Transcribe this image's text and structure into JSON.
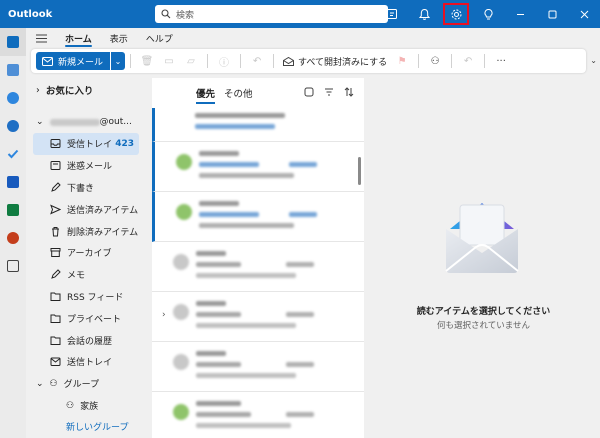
{
  "app": {
    "title": "Outlook"
  },
  "search": {
    "placeholder": "検索"
  },
  "titlebar": {
    "icons": [
      "note-icon",
      "bell-icon",
      "gear-icon",
      "lightbulb-icon",
      "minimize-icon",
      "maximize-icon",
      "close-icon"
    ],
    "highlight_color": "#e81123"
  },
  "rail": {
    "items": [
      "mail-icon",
      "calendar-icon",
      "people-icon",
      "groups-icon",
      "todo-icon",
      "word-icon",
      "excel-icon",
      "powerpoint-icon",
      "apps-icon"
    ]
  },
  "tabs": [
    {
      "label": "ホーム",
      "active": true
    },
    {
      "label": "表示",
      "active": false
    },
    {
      "label": "ヘルプ",
      "active": false
    }
  ],
  "ribbon": {
    "new_mail": "新規メール",
    "mark_all_read": "すべて開封済みにする"
  },
  "folders": {
    "favorites": "お気に入り",
    "account": "@out...",
    "items": [
      {
        "label": "受信トレイ",
        "count": "423",
        "icon": "inbox-icon",
        "selected": true
      },
      {
        "label": "迷惑メール",
        "icon": "junk-icon"
      },
      {
        "label": "下書き",
        "icon": "draft-icon"
      },
      {
        "label": "送信済みアイテム",
        "icon": "sent-icon"
      },
      {
        "label": "削除済みアイテム",
        "icon": "trash-icon"
      },
      {
        "label": "アーカイブ",
        "icon": "archive-icon"
      },
      {
        "label": "メモ",
        "icon": "note-icon"
      },
      {
        "label": "RSS フィード",
        "icon": "folder-icon"
      },
      {
        "label": "プライベート",
        "icon": "folder-icon"
      },
      {
        "label": "会話の履歴",
        "icon": "folder-icon"
      },
      {
        "label": "送信トレイ",
        "icon": "outbox-icon"
      }
    ],
    "groups_header": "グループ",
    "group_item": "家族",
    "new_group": "新しいグループ"
  },
  "message_list": {
    "tab_focused": "優先",
    "tab_other": "その他"
  },
  "reading_pane": {
    "title": "読むアイテムを選択してください",
    "subtitle": "何も選択されていません"
  },
  "colors": {
    "accent": "#0f6cbd",
    "selected_bg": "#d3e3f5"
  }
}
